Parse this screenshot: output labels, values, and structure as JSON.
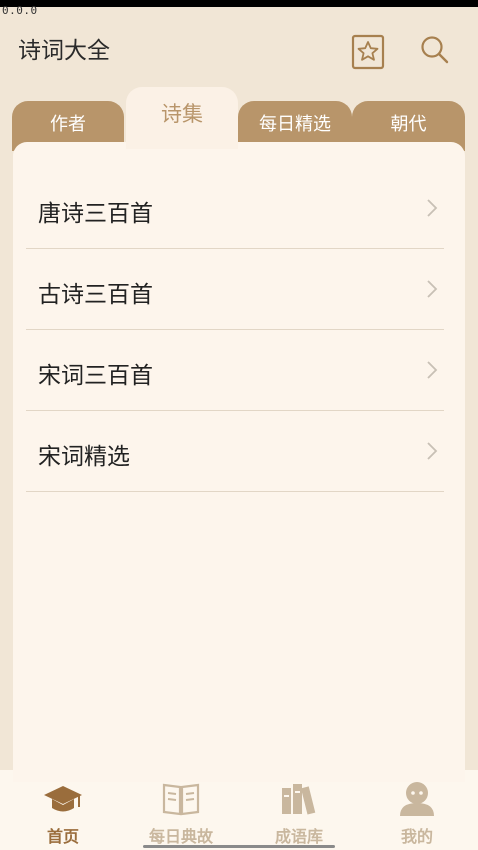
{
  "status": {
    "text": "0.0.0"
  },
  "header": {
    "title": "诗词大全",
    "favorite_icon": "star-bookmark-icon",
    "search_icon": "search-icon"
  },
  "tabs": [
    {
      "label": "作者",
      "active": false
    },
    {
      "label": "诗集",
      "active": true
    },
    {
      "label": "每日精选",
      "active": false
    },
    {
      "label": "朝代",
      "active": false
    }
  ],
  "collections": [
    {
      "label": "唐诗三百首"
    },
    {
      "label": "古诗三百首"
    },
    {
      "label": "宋词三百首"
    },
    {
      "label": "宋词精选"
    }
  ],
  "bottom_nav": [
    {
      "label": "首页",
      "icon": "graduation-cap-icon",
      "active": true
    },
    {
      "label": "每日典故",
      "icon": "open-book-icon",
      "active": false
    },
    {
      "label": "成语库",
      "icon": "bookshelf-icon",
      "active": false
    },
    {
      "label": "我的",
      "icon": "user-avatar-icon",
      "active": false
    }
  ],
  "colors": {
    "accent": "#b8956a",
    "background": "#f1e6d6",
    "panel": "#fdf5ec",
    "nav_active": "#9a6d3c",
    "nav_inactive": "#c9b79e"
  }
}
